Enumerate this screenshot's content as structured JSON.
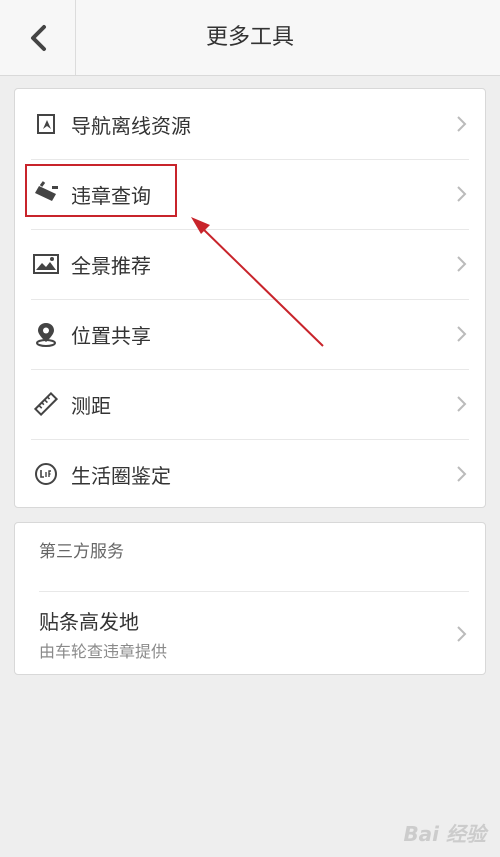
{
  "header": {
    "title": "更多工具"
  },
  "tools": [
    {
      "label": "导航离线资源",
      "icon": "offline-map-icon"
    },
    {
      "label": "违章查询",
      "icon": "car-violation-icon"
    },
    {
      "label": "全景推荐",
      "icon": "panorama-icon"
    },
    {
      "label": "位置共享",
      "icon": "location-share-icon"
    },
    {
      "label": "测距",
      "icon": "ruler-icon"
    },
    {
      "label": "生活圈鉴定",
      "icon": "life-circle-icon"
    }
  ],
  "third_party": {
    "section_title": "第三方服务",
    "service": {
      "title": "贴条高发地",
      "subtitle": "由车轮查违章提供"
    }
  },
  "annotation": {
    "highlight_color": "#c8242b"
  },
  "watermark": "Bai 经验"
}
